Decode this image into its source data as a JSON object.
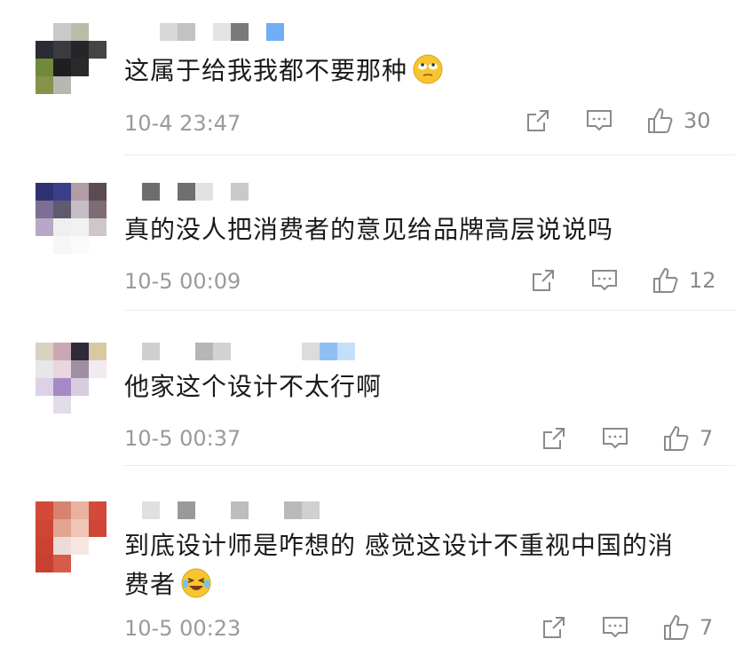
{
  "comments": [
    {
      "text": "这属于给我我都不要那种",
      "time": "10-4 23:47",
      "likes": "30",
      "emoji": "rolling-eyes-emoji"
    },
    {
      "text": "真的没人把消费者的意见给品牌高层说说吗",
      "time": "10-5 00:09",
      "likes": "12"
    },
    {
      "text": "他家这个设计不太行啊",
      "time": "10-5 00:37",
      "likes": "7"
    },
    {
      "text_line1": "到底设计师是咋想的  感觉这设计不重视中国的消",
      "text_line2": "费者",
      "time": "10-5 00:23",
      "likes": "7",
      "emoji": "laugh-cry-emoji"
    }
  ],
  "icons": {
    "share": "share-icon",
    "comment": "comment-icon",
    "like": "thumbs-up-icon"
  }
}
